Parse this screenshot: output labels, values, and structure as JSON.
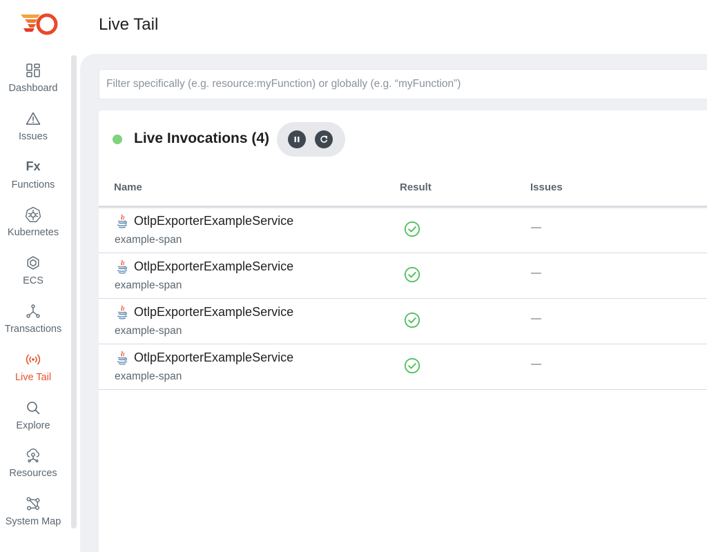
{
  "page": {
    "title": "Live Tail"
  },
  "colors": {
    "accent": "#e8512a",
    "live_indicator": "#7fd37d",
    "success": "#4cbf57"
  },
  "sidebar": {
    "items": [
      {
        "label": "Dashboard",
        "icon": "dashboard-icon",
        "active": false
      },
      {
        "label": "Issues",
        "icon": "warning-icon",
        "active": false
      },
      {
        "label": "Functions",
        "icon": "fx-icon",
        "active": false,
        "glyph": "Fx"
      },
      {
        "label": "Kubernetes",
        "icon": "kubernetes-icon",
        "active": false
      },
      {
        "label": "ECS",
        "icon": "ecs-icon",
        "active": false
      },
      {
        "label": "Transactions",
        "icon": "transactions-icon",
        "active": false
      },
      {
        "label": "Live Tail",
        "icon": "live-tail-icon",
        "active": true,
        "glyph": "((•))"
      },
      {
        "label": "Explore",
        "icon": "search-icon",
        "active": false
      },
      {
        "label": "Resources",
        "icon": "resources-icon",
        "active": false
      },
      {
        "label": "System Map",
        "icon": "system-map-icon",
        "active": false
      }
    ]
  },
  "filter": {
    "placeholder": "Filter specifically (e.g. resource:myFunction) or globally (e.g. “myFunction”)",
    "value": ""
  },
  "invocations": {
    "title": "Live Invocations (4)",
    "controls": {
      "pause": "pause-icon",
      "refresh": "refresh-icon"
    },
    "columns": {
      "name": "Name",
      "result": "Result",
      "issues": "Issues"
    },
    "rows": [
      {
        "service": "OtlpExporterExampleService",
        "span": "example-span",
        "result": "success",
        "issues": "—"
      },
      {
        "service": "OtlpExporterExampleService",
        "span": "example-span",
        "result": "success",
        "issues": "—"
      },
      {
        "service": "OtlpExporterExampleService",
        "span": "example-span",
        "result": "success",
        "issues": "—"
      },
      {
        "service": "OtlpExporterExampleService",
        "span": "example-span",
        "result": "success",
        "issues": "—"
      }
    ]
  }
}
